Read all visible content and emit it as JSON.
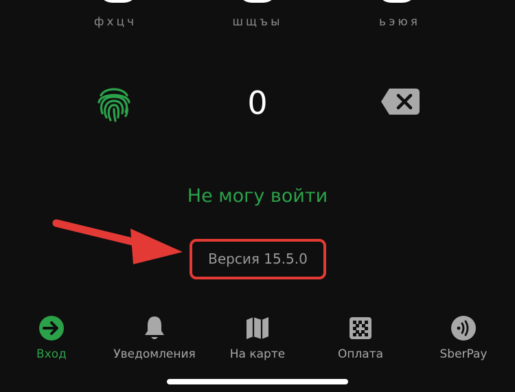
{
  "keypad": {
    "letters": [
      "фхцч",
      "шщъы",
      "ьэюя"
    ],
    "zero_label": "0",
    "fingerprint_icon": "fingerprint-icon",
    "backspace_icon": "backspace-icon"
  },
  "login": {
    "cant_login_label": "Не могу войти",
    "version_text": "Версия 15.5.0"
  },
  "annotation": {
    "arrow_color": "#e43a36",
    "highlight_color": "#e43a36"
  },
  "tabbar": {
    "items": [
      {
        "label": "Вход",
        "icon": "enter-icon",
        "active": true
      },
      {
        "label": "Уведомления",
        "icon": "bell-icon",
        "active": false
      },
      {
        "label": "На карте",
        "icon": "map-icon",
        "active": false
      },
      {
        "label": "Оплата",
        "icon": "qr-code-icon",
        "active": false
      },
      {
        "label": "SberPay",
        "icon": "contactless-icon",
        "active": false
      }
    ]
  },
  "colors": {
    "background": "#0f0f0f",
    "accent_green": "#2ba24a",
    "muted_text": "#9a9a9a",
    "icon_gray": "#a8a8a8"
  }
}
